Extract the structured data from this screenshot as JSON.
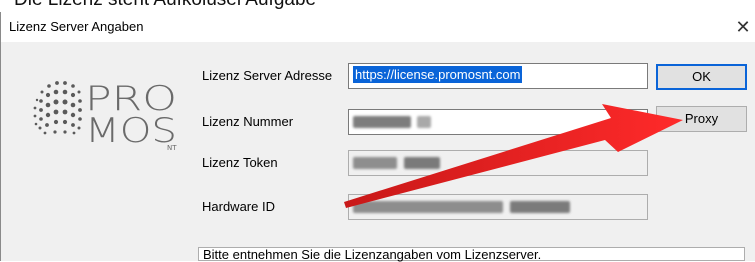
{
  "clipped_heading": "Die Lizenz steht Aufkolüsel Aufgabe",
  "window": {
    "title": "Lizenz Server Angaben",
    "close_glyph": "✕"
  },
  "logo": {
    "line1": "PRO",
    "line2": "MOS",
    "suffix": "NT"
  },
  "form": {
    "server_address_label": "Lizenz Server Adresse",
    "server_address_value": "https://license.promosnt.com",
    "license_number_label": "Lizenz Nummer",
    "license_token_label": "Lizenz Token",
    "hardware_id_label": "Hardware ID"
  },
  "buttons": {
    "ok_label": "OK",
    "proxy_label": "Proxy"
  },
  "status_text": "Bitte entnehmen Sie die Lizenzangaben vom Lizenzserver.",
  "colors": {
    "selection": "#0a64d8",
    "annotation_arrow": "#e41f1f"
  }
}
